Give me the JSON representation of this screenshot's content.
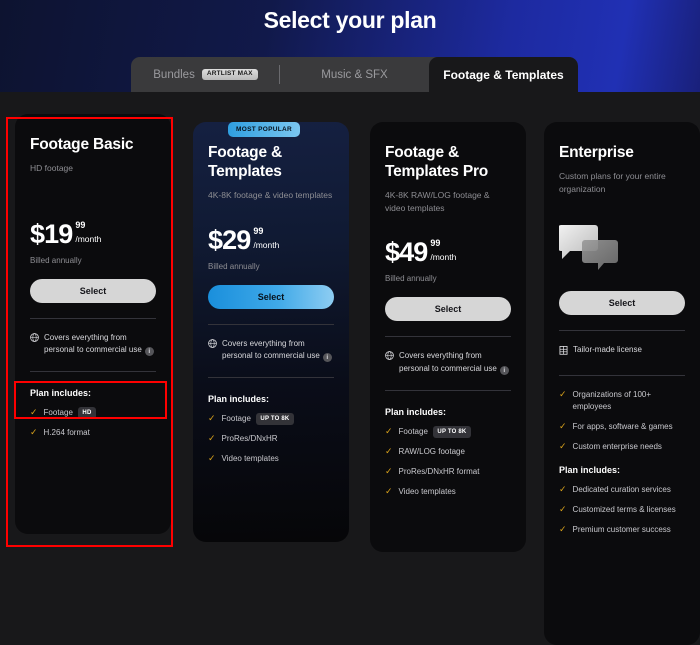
{
  "header": {
    "title": "Select your plan"
  },
  "tabs": [
    {
      "label": "Bundles",
      "badge": "ARTLIST MAX",
      "active": false
    },
    {
      "label": "Music & SFX",
      "badge": "",
      "active": false
    },
    {
      "label": "Footage & Templates",
      "badge": "",
      "active": true
    }
  ],
  "badges": {
    "most_popular": "MOST POPULAR"
  },
  "license_note": {
    "text": "Covers everything from personal to commercial use",
    "info_glyph": "i",
    "icon": "globe-icon"
  },
  "enterprise_license": {
    "text": "Tailor-made license",
    "icon": "building-icon"
  },
  "includes_label": "Plan includes:",
  "select_label": "Select",
  "plans": [
    {
      "name": "Footage Basic",
      "subtitle": "HD footage",
      "price_main": "$19",
      "price_cents": "99",
      "price_per": "/month",
      "billed": "Billed annually",
      "features": [
        {
          "text": "Footage",
          "badge": "HD"
        },
        {
          "text": "H.264 format",
          "badge": ""
        }
      ]
    },
    {
      "name": "Footage & Templates",
      "subtitle": "4K-8K footage & video templates",
      "price_main": "$29",
      "price_cents": "99",
      "price_per": "/month",
      "billed": "Billed annually",
      "features": [
        {
          "text": "Footage",
          "badge": "UP TO 8K"
        },
        {
          "text": "ProRes/DNxHR",
          "badge": ""
        },
        {
          "text": "Video templates",
          "badge": ""
        }
      ]
    },
    {
      "name": "Footage & Templates Pro",
      "subtitle": "4K-8K RAW/LOG footage & video templates",
      "price_main": "$49",
      "price_cents": "99",
      "price_per": "/month",
      "billed": "Billed annually",
      "features": [
        {
          "text": "Footage",
          "badge": "UP TO 8K"
        },
        {
          "text": "RAW/LOG footage",
          "badge": ""
        },
        {
          "text": "ProRes/DNxHR format",
          "badge": ""
        },
        {
          "text": "Video templates",
          "badge": ""
        }
      ]
    },
    {
      "name": "Enterprise",
      "subtitle": "Custom plans for your entire organization",
      "highlights": [
        "Organizations of 100+ employees",
        "For apps, software & games",
        "Custom enterprise needs"
      ],
      "features": [
        {
          "text": "Dedicated curation services",
          "badge": ""
        },
        {
          "text": "Customized terms & licenses",
          "badge": ""
        },
        {
          "text": "Premium customer success",
          "badge": ""
        }
      ]
    }
  ],
  "colors": {
    "accent_blue": "#3fa9e8",
    "check_gold": "#d9a21b",
    "annotation_red": "#ff0000",
    "card_bg": "#0b0b0d",
    "strip_bg": "#18181a"
  }
}
